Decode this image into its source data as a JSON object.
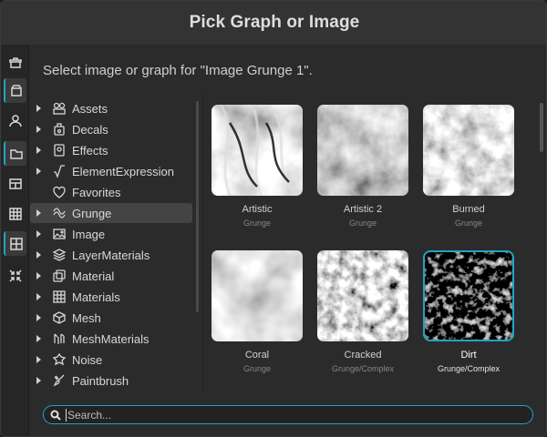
{
  "dialog": {
    "title": "Pick Graph or Image"
  },
  "subtitle": "Select image or graph for \"Image Grunge 1\".",
  "sidebar": {
    "buttons": [
      {
        "name": "package-icon",
        "active": false
      },
      {
        "name": "box-icon",
        "active": true
      },
      {
        "name": "user-icon",
        "active": false
      },
      {
        "name": "folder-icon",
        "active": true
      },
      {
        "name": "table-icon",
        "active": false
      },
      {
        "name": "grid-icon",
        "active": false
      },
      {
        "name": "grid-large-icon",
        "active": true
      },
      {
        "name": "collapse-icon",
        "active": false
      }
    ]
  },
  "tree": {
    "items": [
      {
        "label": "Assets",
        "icon": "assets-icon",
        "selected": false,
        "expandable": true
      },
      {
        "label": "Decals",
        "icon": "decals-icon",
        "selected": false,
        "expandable": true
      },
      {
        "label": "Effects",
        "icon": "effects-icon",
        "selected": false,
        "expandable": true
      },
      {
        "label": "ElementExpression",
        "icon": "sqrt-icon",
        "selected": false,
        "expandable": true
      },
      {
        "label": "Favorites",
        "icon": "heart-icon",
        "selected": false,
        "expandable": false
      },
      {
        "label": "Grunge",
        "icon": "grunge-icon",
        "selected": true,
        "expandable": true
      },
      {
        "label": "Image",
        "icon": "image-icon",
        "selected": false,
        "expandable": true
      },
      {
        "label": "LayerMaterials",
        "icon": "layers-icon",
        "selected": false,
        "expandable": true
      },
      {
        "label": "Material",
        "icon": "material-icon",
        "selected": false,
        "expandable": true
      },
      {
        "label": "Materials",
        "icon": "materials-icon",
        "selected": false,
        "expandable": true
      },
      {
        "label": "Mesh",
        "icon": "mesh-icon",
        "selected": false,
        "expandable": true
      },
      {
        "label": "MeshMaterials",
        "icon": "mesh-materials-icon",
        "selected": false,
        "expandable": true
      },
      {
        "label": "Noise",
        "icon": "noise-icon",
        "selected": false,
        "expandable": true
      },
      {
        "label": "Paintbrush",
        "icon": "paintbrush-icon",
        "selected": false,
        "expandable": true
      }
    ]
  },
  "grid": {
    "tiles": [
      {
        "name": "Artistic",
        "category": "Grunge",
        "selected": false,
        "texture": "artistic"
      },
      {
        "name": "Artistic 2",
        "category": "Grunge",
        "selected": false,
        "texture": "artistic2"
      },
      {
        "name": "Burned",
        "category": "Grunge",
        "selected": false,
        "texture": "burned"
      },
      {
        "name": "Coral",
        "category": "Grunge",
        "selected": false,
        "texture": "coral"
      },
      {
        "name": "Cracked",
        "category": "Grunge/Complex",
        "selected": false,
        "texture": "cracked"
      },
      {
        "name": "Dirt",
        "category": "Grunge/Complex",
        "selected": true,
        "texture": "dirt"
      }
    ]
  },
  "search": {
    "placeholder": "Search...",
    "value": ""
  },
  "colors": {
    "accent": "#20a4c4",
    "background": "#2b2b2b",
    "titlebar": "#333333"
  }
}
